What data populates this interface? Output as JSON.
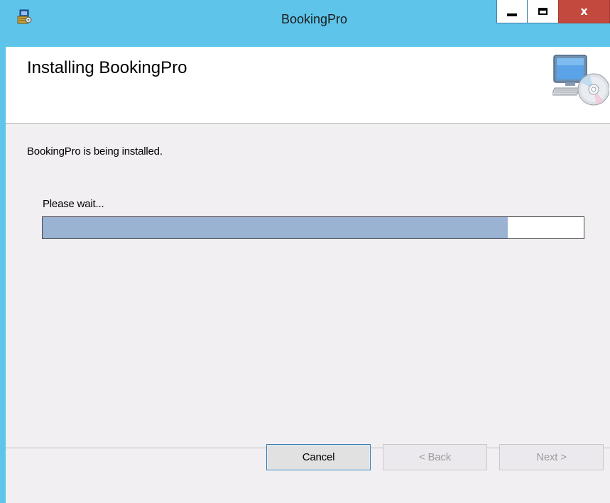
{
  "window": {
    "title": "BookingPro",
    "controls": {
      "minimize_icon": "minimize-icon",
      "maximize_icon": "maximize-icon",
      "close_glyph": "x"
    },
    "colors": {
      "title_bar": "#5ec4ea",
      "close_button": "#c3493f",
      "progress_fill": "#9ab3d3"
    }
  },
  "header": {
    "title": "Installing BookingPro",
    "graphic_icon": "computer-cd-icon"
  },
  "body": {
    "status": "BookingPro is being installed.",
    "wait_label": "Please wait...",
    "progress_percent": 86
  },
  "footer": {
    "cancel_label": "Cancel",
    "back_label": "< Back",
    "next_label": "Next >"
  }
}
